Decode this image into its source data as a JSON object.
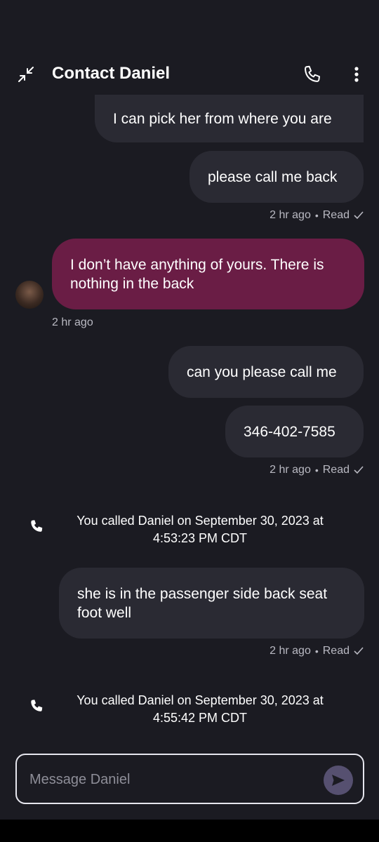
{
  "header": {
    "title": "Contact Daniel",
    "collapse_icon": "collapse-arrows-icon",
    "phone_icon": "phone-icon",
    "more_icon": "more-vertical-icon"
  },
  "messages": [
    {
      "direction": "out",
      "text": "I can pick her from where you are"
    },
    {
      "direction": "out",
      "text": "please call me back"
    },
    {
      "meta": {
        "time": "2 hr ago",
        "status": "Read"
      }
    },
    {
      "direction": "in",
      "text": "I don’t have anything of yours. There is nothing in the back",
      "time": "2 hr ago"
    },
    {
      "direction": "out",
      "text": "can you please call me"
    },
    {
      "direction": "out",
      "text": "346-402-7585"
    },
    {
      "meta": {
        "time": "2 hr ago",
        "status": "Read"
      }
    },
    {
      "call": "You called Daniel on September 30, 2023 at 4:53:23 PM CDT"
    },
    {
      "direction": "out",
      "text": "she is in the passenger side back seat foot well"
    },
    {
      "meta": {
        "time": "2 hr ago",
        "status": "Read"
      }
    },
    {
      "call": "You called Daniel on September 30, 2023 at 4:55:42 PM CDT"
    }
  ],
  "composer": {
    "placeholder": "Message Daniel",
    "send_icon": "send-icon"
  },
  "colors": {
    "background": "#1b1b22",
    "bubble_out": "#2a2a33",
    "bubble_in": "#6a1d45",
    "send_button": "#565070"
  }
}
